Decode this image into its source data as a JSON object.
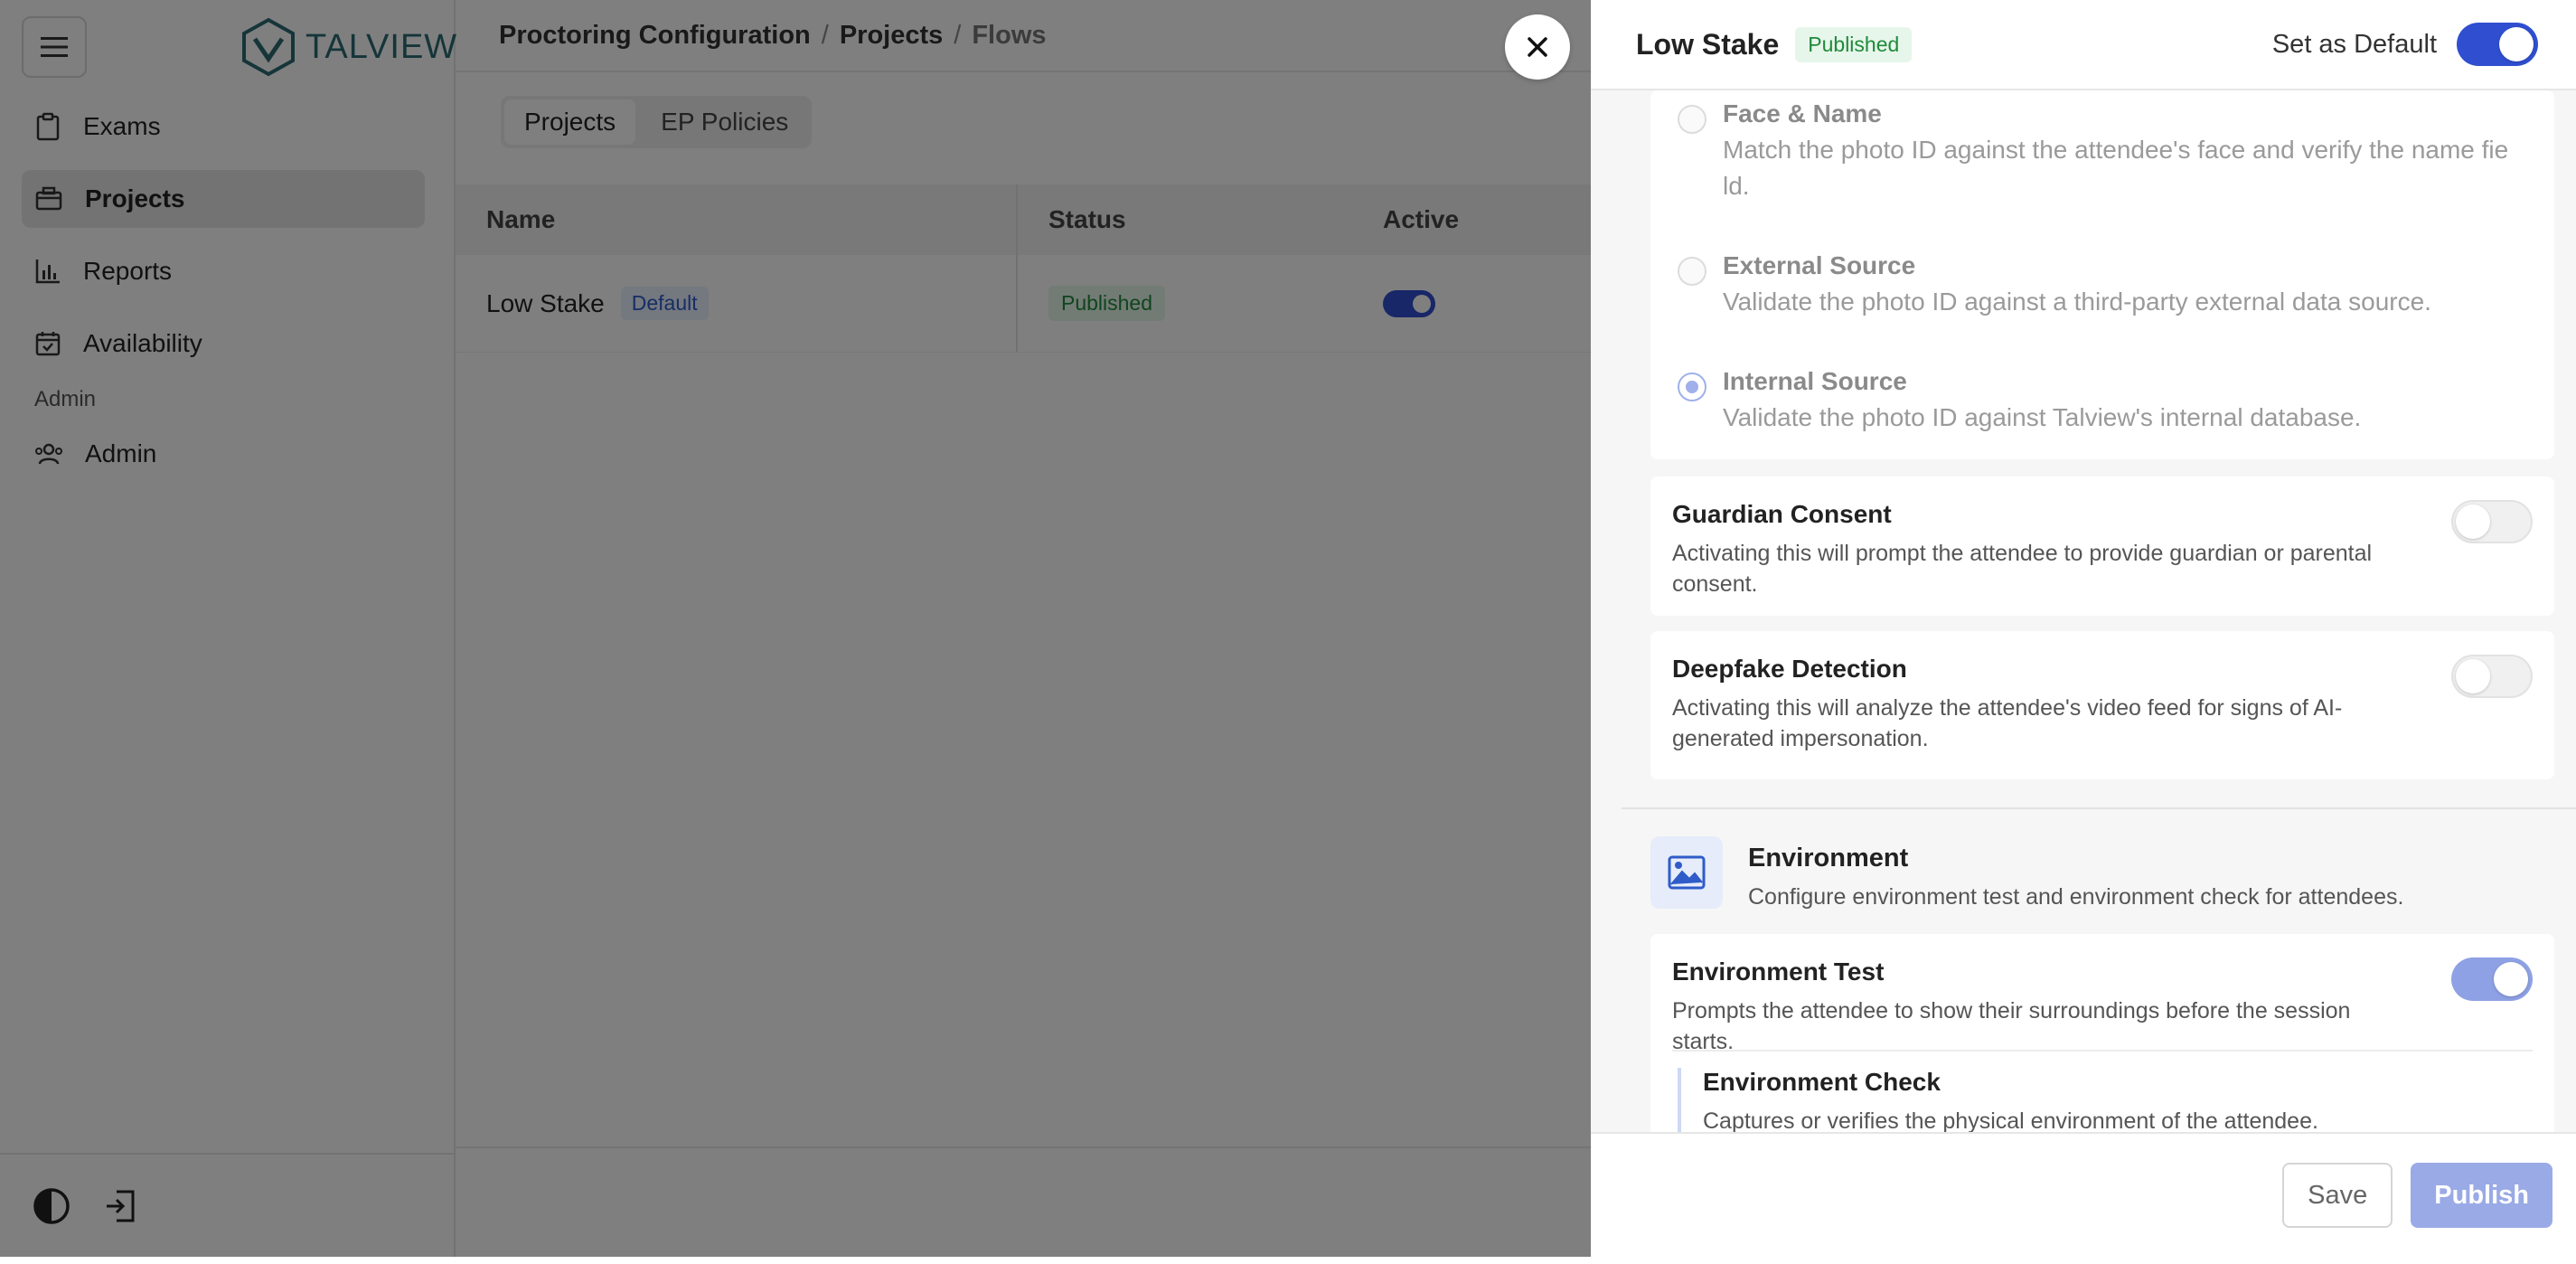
{
  "app": {
    "logo_text": "TALVIEW",
    "nav": [
      {
        "label": "Exams",
        "icon": "clipboard-icon"
      },
      {
        "label": "Projects",
        "icon": "projects-icon"
      },
      {
        "label": "Reports",
        "icon": "bar-chart-icon"
      },
      {
        "label": "Availability",
        "icon": "calendar-icon"
      }
    ],
    "admin_section": "Admin",
    "admin_item": "Admin"
  },
  "breadcrumb": {
    "level1": "Proctoring Configuration",
    "level2": "Projects",
    "level3": "Flows",
    "separator": "/"
  },
  "tabs": [
    "Projects",
    "EP Policies"
  ],
  "table": {
    "headers": [
      "Name",
      "Status",
      "Active"
    ],
    "rows": [
      {
        "name": "Low Stake",
        "default_badge": "Default",
        "status": "Published",
        "active": true
      }
    ]
  },
  "drawer": {
    "title": "Low Stake",
    "status_badge": "Published",
    "default_label": "Set as Default",
    "default_on": true,
    "photo_id_options": [
      {
        "title": "Face & Name",
        "desc": "Match the photo ID against the attendee's face and verify the name fie ld.",
        "selected": false
      },
      {
        "title": "External Source",
        "desc": "Validate the photo ID against a third-party external data source.",
        "selected": false
      },
      {
        "title": "Internal Source",
        "desc": "Validate the photo ID against Talview's internal database.",
        "selected": true
      }
    ],
    "guardian": {
      "title": "Guardian Consent",
      "desc": "Activating this will prompt the attendee to provide guardian or parental consent.",
      "on": false
    },
    "deepfake": {
      "title": "Deepfake Detection",
      "desc": "Activating this will analyze the attendee's video feed for signs of AI-generated impersonation.",
      "on": false
    },
    "environment": {
      "title": "Environment",
      "desc": "Configure environment test and environment check for attendees.",
      "test_title": "Environment Test",
      "test_desc": "Prompts the attendee to show their surroundings before the session starts.",
      "test_on": true,
      "check_title": "Environment Check",
      "check_desc": "Captures or verifies the physical environment of the attendee."
    },
    "save_label": "Save",
    "publish_label": "Publish"
  },
  "colors": {
    "accent": "#2f4fd0",
    "accent_muted": "#9aaae6",
    "success": "#1f8a3a"
  }
}
